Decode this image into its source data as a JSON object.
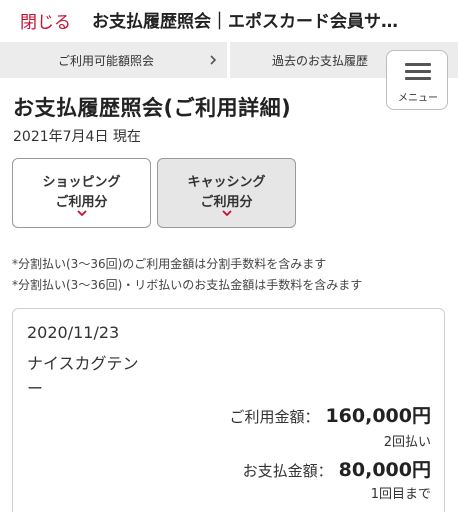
{
  "header": {
    "close_label": "閉じる",
    "title": "お支払履歴照会｜エポスカード会員サ…"
  },
  "tabs": [
    {
      "label": "ご利用可能額照会"
    },
    {
      "label": "過去のお支払履歴"
    }
  ],
  "menu": {
    "label": "メニュー",
    "icon": "hamburger-icon"
  },
  "page": {
    "title": "お支払履歴照会(ご利用詳細)",
    "as_of": "2021年7月4日 現在"
  },
  "segments": [
    {
      "line1": "ショッピング",
      "line2": "ご利用分",
      "selected": false
    },
    {
      "line1": "キャッシング",
      "line2": "ご利用分",
      "selected": true
    }
  ],
  "notes": [
    "*分割払い(3〜36回)のご利用金額は分割手数料を含みます",
    "*分割払い(3〜36回)・リボ払いのお支払金額は手数料を含みます"
  ],
  "transaction": {
    "date": "2020/11/23",
    "merchant": "ナイスカグテン",
    "dash": "ー",
    "use_amount_label": "ご利用金額：",
    "use_amount": "160,000円",
    "installments": "2回払い",
    "pay_amount_label": "お支払金額：",
    "pay_amount": "80,000円",
    "installment_progress": "1回目まで"
  },
  "colors": {
    "accent": "#c8102e",
    "tab_bg": "#ececec",
    "selected_segment_bg": "#e6e6e6"
  }
}
